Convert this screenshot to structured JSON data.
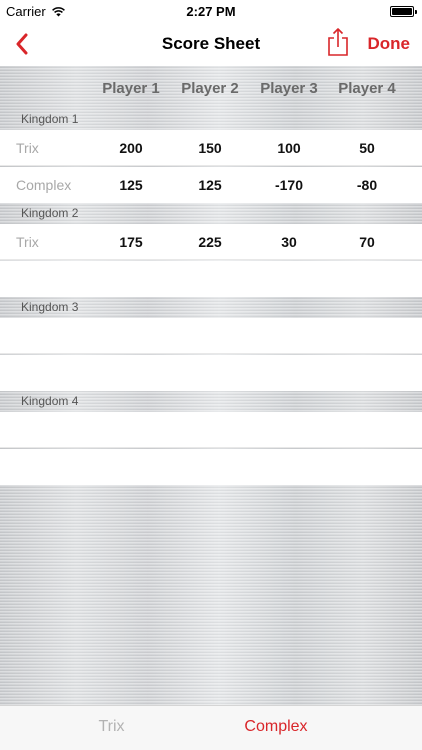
{
  "status_bar": {
    "carrier": "Carrier",
    "time": "2:27 PM"
  },
  "nav": {
    "title": "Score Sheet",
    "done_label": "Done"
  },
  "players": [
    "Player 1",
    "Player 2",
    "Player 3",
    "Player 4"
  ],
  "kingdoms": [
    {
      "title": "Kingdom 1",
      "rows": [
        {
          "label": "Trix",
          "scores": [
            "200",
            "150",
            "100",
            "50"
          ]
        },
        {
          "label": "Complex",
          "scores": [
            "125",
            "125",
            "-170",
            "-80"
          ]
        }
      ]
    },
    {
      "title": "Kingdom 2",
      "rows": [
        {
          "label": "Trix",
          "scores": [
            "175",
            "225",
            "30",
            "70"
          ]
        }
      ]
    },
    {
      "title": "Kingdom 3",
      "rows": []
    },
    {
      "title": "Kingdom 4",
      "rows": []
    }
  ],
  "tabs": {
    "trix": "Trix",
    "complex": "Complex",
    "selected": "complex"
  },
  "colors": {
    "accent": "#d9262a",
    "muted_label": "#a8a8a8",
    "player_header": "#6a6a6a"
  },
  "icons": {
    "back": "chevron-left-icon",
    "share": "share-icon",
    "wifi": "wifi-icon",
    "battery": "battery-icon"
  }
}
